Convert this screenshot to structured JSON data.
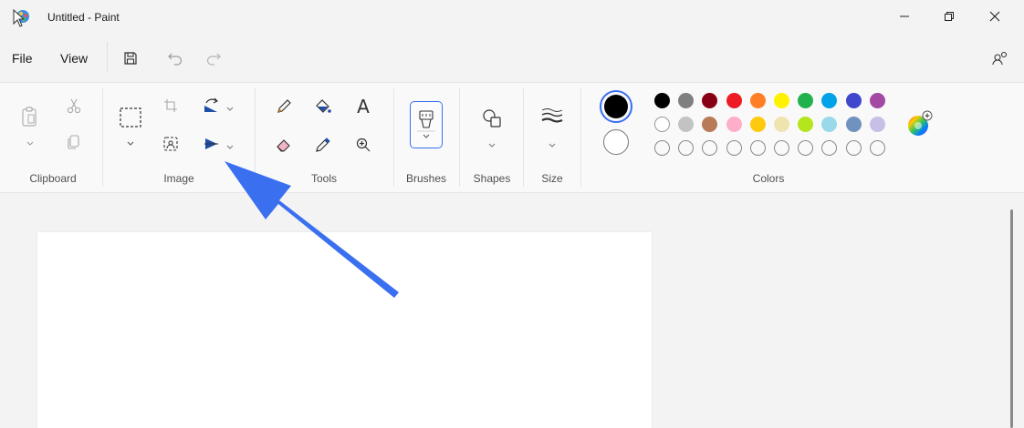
{
  "window": {
    "title": "Untitled - Paint",
    "icon": "paint-app-icon",
    "controls": [
      "minimize-icon",
      "restore-icon",
      "close-icon"
    ]
  },
  "menu": {
    "file": "File",
    "view": "View",
    "icons": [
      "save-icon",
      "undo-icon",
      "redo-icon",
      "share-icon"
    ]
  },
  "ribbon": {
    "groups": {
      "clipboard": "Clipboard",
      "image": "Image",
      "tools": "Tools",
      "brushes": "Brushes",
      "shapes": "Shapes",
      "size": "Size",
      "colors": "Colors"
    },
    "text_tool": "A"
  },
  "colors": {
    "primary": "#000000",
    "secondary": "#ffffff",
    "palette_row1": [
      "#000000",
      "#7f7f7f",
      "#880015",
      "#ed1c24",
      "#ff7f27",
      "#fff200",
      "#22b14c",
      "#00a2e8",
      "#3f48cc",
      "#a349a4"
    ],
    "palette_row2": [
      "#ffffff",
      "#c3c3c3",
      "#b97a57",
      "#ffaec9",
      "#ffc90e",
      "#efe4b0",
      "#b5e61d",
      "#99d9ea",
      "#7092be",
      "#c8bfe7"
    ],
    "palette_row3_count": 10,
    "accent": "#3a6ff0"
  },
  "annotation": {
    "arrow_color": "#3a6ff0"
  }
}
